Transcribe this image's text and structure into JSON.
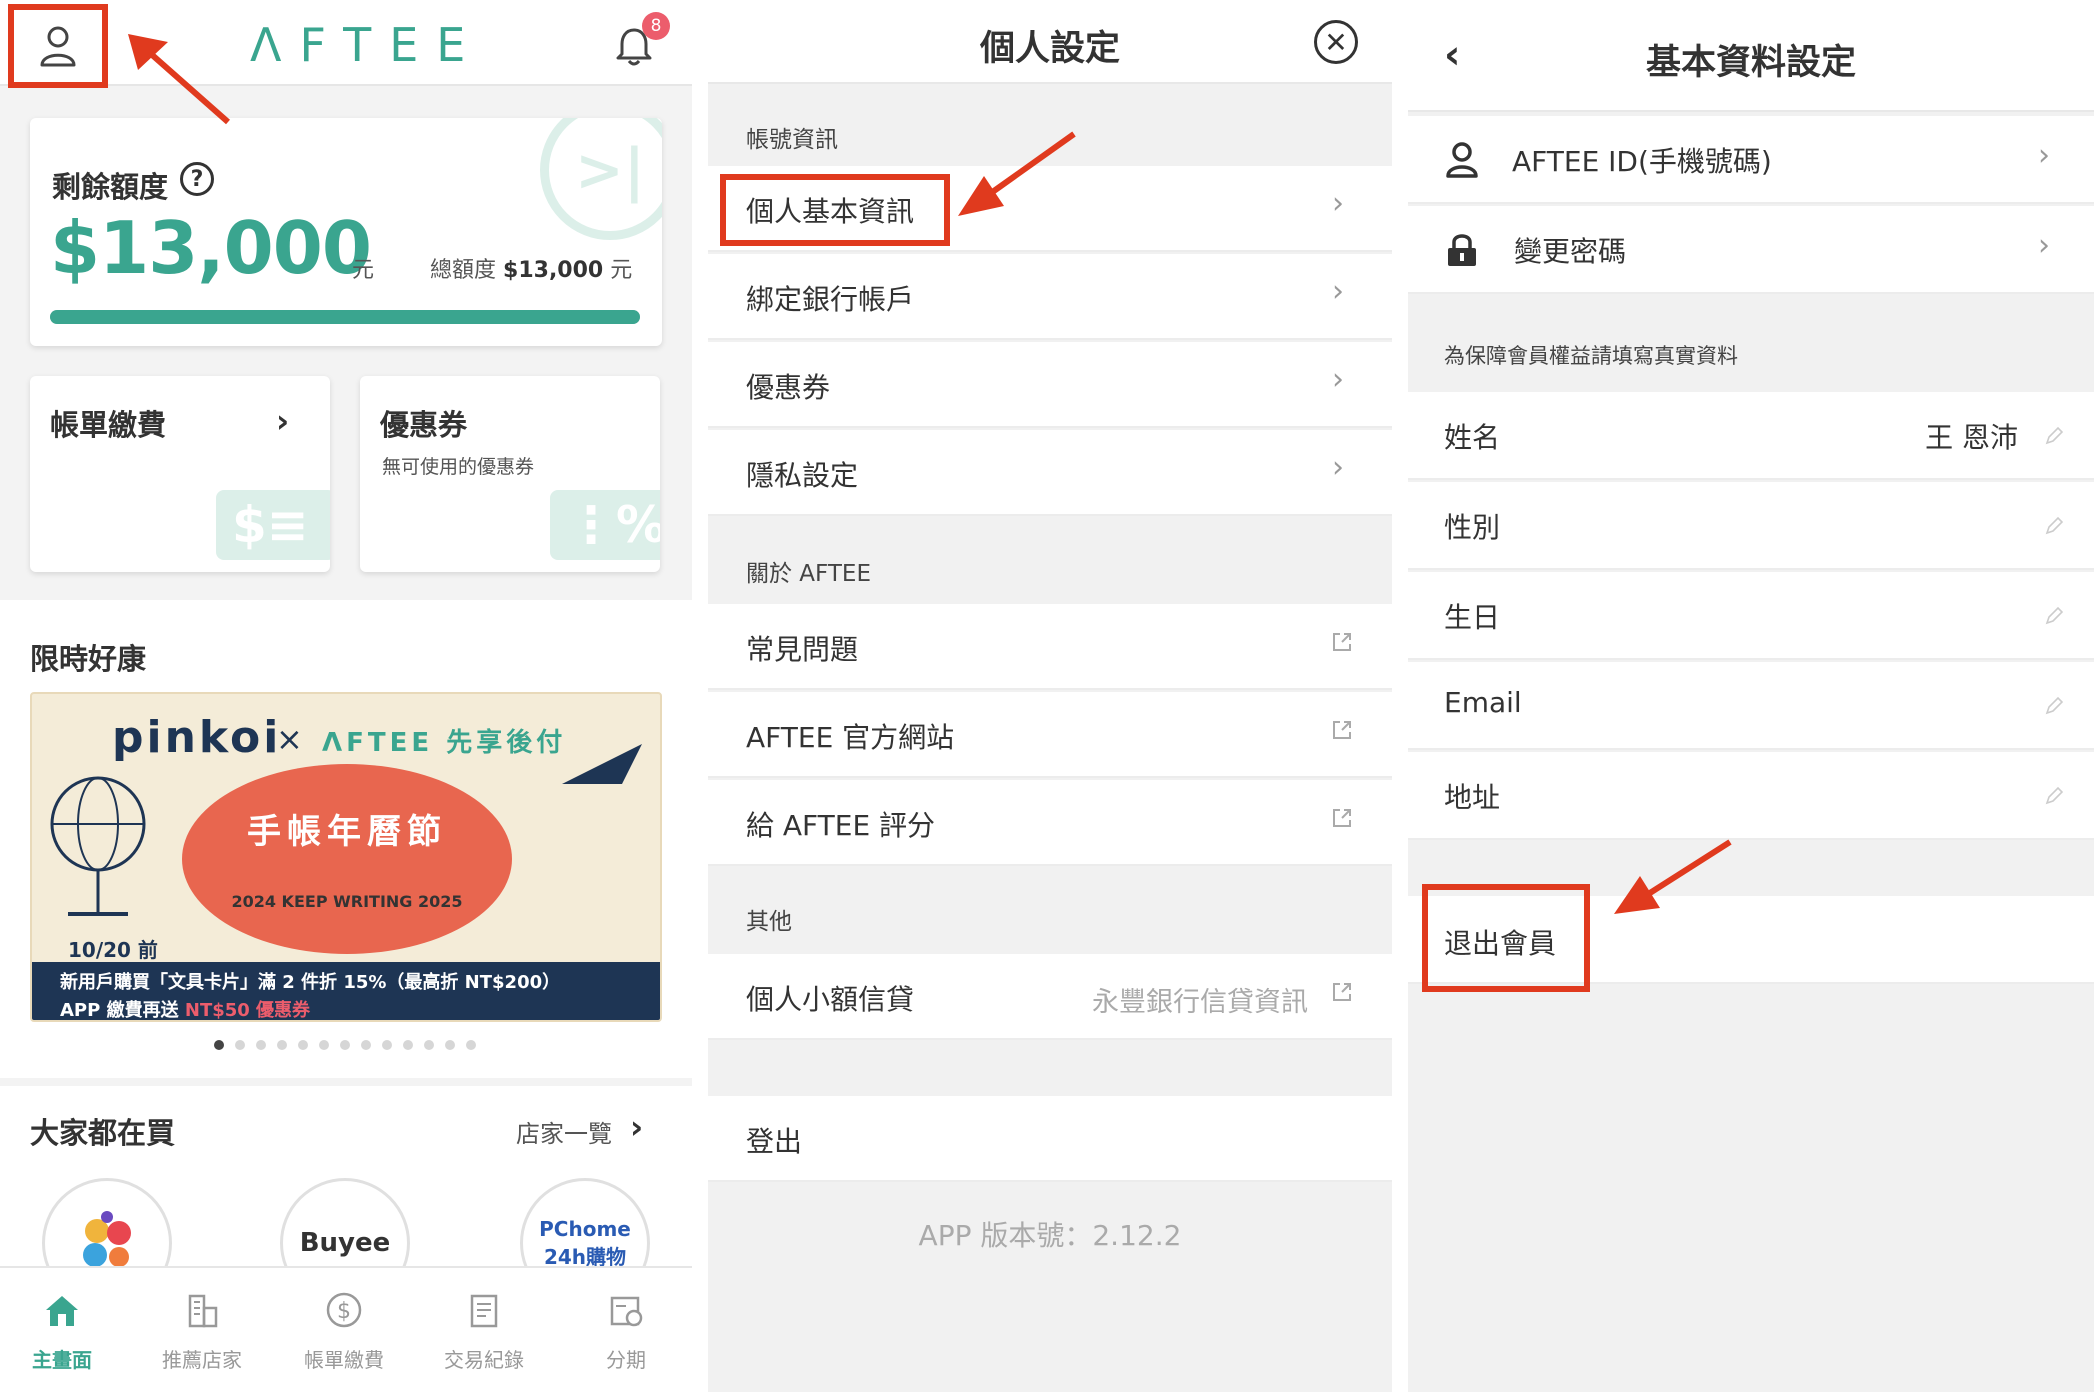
{
  "home": {
    "logo": "ΛFTEE",
    "notification_count": "8",
    "credit": {
      "label": "剩餘額度",
      "help": "?",
      "amount": "$13,000",
      "unit": "元",
      "total_label": "總額度",
      "total_amount": "$13,000",
      "total_unit": "元",
      "used_fraction": 1.0
    },
    "bill_card": {
      "title": "帳單繳費"
    },
    "coupon_card": {
      "title": "優惠券",
      "subtitle": "無可使用的優惠券"
    },
    "promo_title": "限時好康",
    "banner": {
      "brand": "pinkoi",
      "x": "×",
      "partner": "ΛFTEE 先享後付",
      "headline": "手帳年曆節",
      "subline": "2024 KEEP WRITING 2025",
      "date": "10/20 前",
      "line1": "新用戶購買「文具卡片」滿 2 件折 15%（最高折 NT$200）",
      "line2_prefix": "APP 繳費再送",
      "line2_highlight": "NT$50 優惠券"
    },
    "carousel": {
      "count": 13,
      "active": 0
    },
    "popular_title": "大家都在買",
    "shop_all": "店家一覽",
    "stores": [
      "",
      "Buyee",
      "PChome 24h購物"
    ],
    "tabs": [
      {
        "label": "主畫面",
        "icon": "home-icon",
        "active": true
      },
      {
        "label": "推薦店家",
        "icon": "buildings-icon",
        "active": false
      },
      {
        "label": "帳單繳費",
        "icon": "dollar-icon",
        "active": false
      },
      {
        "label": "交易紀錄",
        "icon": "receipt-icon",
        "active": false
      },
      {
        "label": "分期",
        "icon": "calendar-icon",
        "active": false
      }
    ]
  },
  "settings": {
    "title": "個人設定",
    "account_group": "帳號資訊",
    "account_items": [
      "個人基本資訊",
      "綁定銀行帳戶",
      "優惠券",
      "隱私設定"
    ],
    "about_group": "關於 AFTEE",
    "about_items": [
      "常見問題",
      "AFTEE 官方網站",
      "給 AFTEE 評分"
    ],
    "other_group": "其他",
    "loan_label": "個人小額信貸",
    "loan_value": "永豐銀行信貸資訊",
    "logout": "登出",
    "version": "APP 版本號：2.12.2"
  },
  "basic": {
    "title": "基本資料設定",
    "id_label": "AFTEE ID(手機號碼)",
    "password_label": "變更密碼",
    "notice": "為保障會員權益請填寫真實資料",
    "fields": [
      {
        "label": "姓名",
        "value": "王 恩沛"
      },
      {
        "label": "性別",
        "value": ""
      },
      {
        "label": "生日",
        "value": ""
      },
      {
        "label": "Email",
        "value": ""
      },
      {
        "label": "地址",
        "value": ""
      }
    ],
    "withdraw": "退出會員"
  },
  "colors": {
    "brand": "#3aa58f",
    "annotation": "#e03a1e",
    "badge": "#ec5d6c",
    "banner_dark": "#1e3554",
    "banner_orange": "#e8664f"
  }
}
